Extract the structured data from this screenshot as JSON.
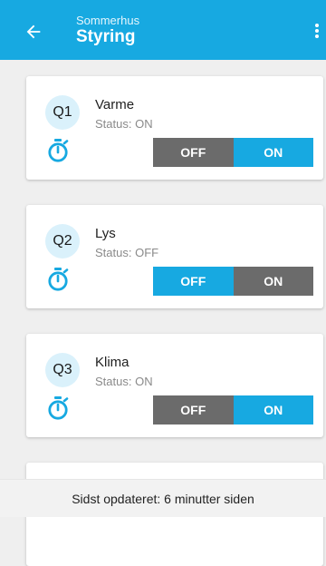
{
  "header": {
    "subtitle": "Sommerhus",
    "title": "Styring",
    "back_icon": "arrow-left-icon",
    "menu_icon": "more-vertical-icon"
  },
  "colors": {
    "accent": "#17a9e1",
    "toggle_inactive": "#6b6b6b",
    "badge_bg": "#daf1fb"
  },
  "toggle_labels": {
    "off": "OFF",
    "on": "ON"
  },
  "outputs": [
    {
      "id": "Q1",
      "name": "Varme",
      "status": "Status: ON",
      "state": "on",
      "timer_icon": "stopwatch-icon"
    },
    {
      "id": "Q2",
      "name": "Lys",
      "status": "Status: OFF",
      "state": "off",
      "timer_icon": "stopwatch-icon"
    },
    {
      "id": "Q3",
      "name": "Klima",
      "status": "Status: ON",
      "state": "on",
      "timer_icon": "stopwatch-icon"
    }
  ],
  "footer": {
    "last_updated": "Sidst opdateret: 6 minutter siden"
  }
}
